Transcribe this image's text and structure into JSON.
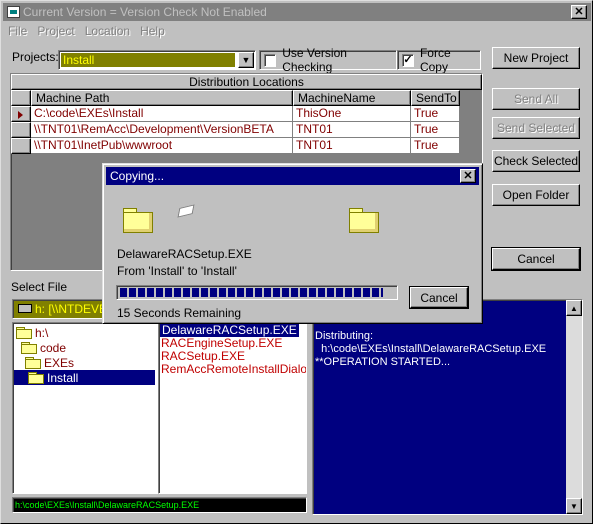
{
  "window": {
    "title": "Current Version = Version Check Not Enabled",
    "close_label": "✕"
  },
  "menu": [
    "File",
    "Project",
    "Location",
    "Help"
  ],
  "projects": {
    "label": "Projects:",
    "value": "Install"
  },
  "options": {
    "version_checking": {
      "label": "Use Version Checking",
      "checked": false
    },
    "force_copy": {
      "label": "Force Copy",
      "checked": true,
      "mark": "✓"
    }
  },
  "grid": {
    "caption": "Distribution Locations",
    "columns": [
      "Machine Path",
      "MachineName",
      "SendTo"
    ],
    "rows": [
      {
        "path": "C:\\code\\EXEs\\Install",
        "machine": "ThisOne",
        "sendto": "True"
      },
      {
        "path": "\\\\TNT01\\RemAcc\\Development\\VersionBETA",
        "machine": "TNT01",
        "sendto": "True"
      },
      {
        "path": "\\\\TNT01\\InetPub\\wwwroot",
        "machine": "TNT01",
        "sendto": "True"
      }
    ]
  },
  "buttons": {
    "new_project": "New Project",
    "send_all": "Send All",
    "send_selected": "Send Selected",
    "check_selected": "Check Selected",
    "open_folder": "Open Folder",
    "cancel": "Cancel"
  },
  "select_file": {
    "label": "Select File",
    "drive": "h: [\\\\NTDEVE",
    "dirs": [
      "h:\\",
      "code",
      "EXEs",
      "Install"
    ],
    "files": [
      "DelawareRACSetup.EXE",
      "RACEngineSetup.EXE",
      "RACSetup.EXE",
      "RemAccRemoteInstallDialog.b"
    ],
    "selected_path": "h:\\code\\EXEs\\Install\\DelawareRACSetup.EXE"
  },
  "log": {
    "lines": [
      "Distributing:",
      "  h:\\code\\EXEs\\Install\\DelawareRACSetup.EXE",
      "**OPERATION STARTED..."
    ]
  },
  "copy_dialog": {
    "title": "Copying...",
    "close_label": "✕",
    "filename": "DelawareRACSetup.EXE",
    "from_to": "From 'Install' to 'Install'",
    "progress_fraction": 0.96,
    "remaining": "15 Seconds Remaining",
    "cancel_label": "Cancel"
  },
  "colors": {
    "title_active": "#000080",
    "title_inactive": "#808080",
    "log_background": "#000080",
    "combo_highlight": "#808000",
    "path_text": "#00ff00"
  },
  "icons": [
    "app-icon",
    "close-icon",
    "dropdown-arrow-icon",
    "row-pointer-icon",
    "drive-icon",
    "folder-icon",
    "paper-icon",
    "scroll-up-icon",
    "scroll-down-icon"
  ]
}
